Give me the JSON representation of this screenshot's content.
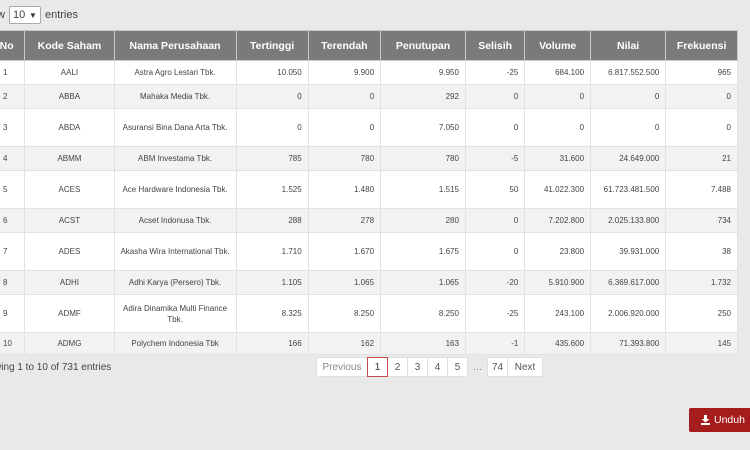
{
  "length": {
    "prefix": "w",
    "value": "10",
    "suffix": "entries"
  },
  "columns": [
    "No",
    "Kode Saham",
    "Nama Perusahaan",
    "Tertinggi",
    "Terendah",
    "Penutupan",
    "Selisih",
    "Volume",
    "Nilai",
    "Frekuensi"
  ],
  "rows": [
    [
      "1",
      "AALI",
      "Astra Agro Lestari Tbk.",
      "10.050",
      "9.900",
      "9.950",
      "-25",
      "684.100",
      "6.817.552.500",
      "965"
    ],
    [
      "2",
      "ABBA",
      "Mahaka Media Tbk.",
      "0",
      "0",
      "292",
      "0",
      "0",
      "0",
      "0"
    ],
    [
      "3",
      "ABDA",
      "Asuransi Bina Dana Arta Tbk.",
      "0",
      "0",
      "7.050",
      "0",
      "0",
      "0",
      "0"
    ],
    [
      "4",
      "ABMM",
      "ABM Investama Tbk.",
      "785",
      "780",
      "780",
      "-5",
      "31.600",
      "24.649.000",
      "21"
    ],
    [
      "5",
      "ACES",
      "Ace Hardware Indonesia Tbk.",
      "1.525",
      "1.480",
      "1.515",
      "50",
      "41.022.300",
      "61.723.481.500",
      "7.488"
    ],
    [
      "6",
      "ACST",
      "Acset Indonusa Tbk.",
      "288",
      "278",
      "280",
      "0",
      "7.202.800",
      "2.025.133.800",
      "734"
    ],
    [
      "7",
      "ADES",
      "Akasha Wira International Tbk.",
      "1.710",
      "1.670",
      "1.675",
      "0",
      "23.800",
      "39.931.000",
      "38"
    ],
    [
      "8",
      "ADHI",
      "Adhi Karya (Persero) Tbk.",
      "1.105",
      "1.065",
      "1.065",
      "-20",
      "5.910.900",
      "6.369.617.000",
      "1.732"
    ],
    [
      "9",
      "ADMF",
      "Adira Dinamika Multi Finance Tbk.",
      "8.325",
      "8.250",
      "8.250",
      "-25",
      "243.100",
      "2.006.920.000",
      "250"
    ],
    [
      "10",
      "ADMG",
      "Polychem Indonesia Tbk",
      "166",
      "162",
      "163",
      "-1",
      "435.600",
      "71.393.800",
      "145"
    ]
  ],
  "info": "wing 1 to 10 of 731 entries",
  "pagination": {
    "previous": "Previous",
    "pages": [
      "1",
      "2",
      "3",
      "4",
      "5"
    ],
    "active": "1",
    "ellipsis": "…",
    "last": "74",
    "next": "Next"
  },
  "download": {
    "label": "Unduh",
    "icon": "download-icon"
  }
}
